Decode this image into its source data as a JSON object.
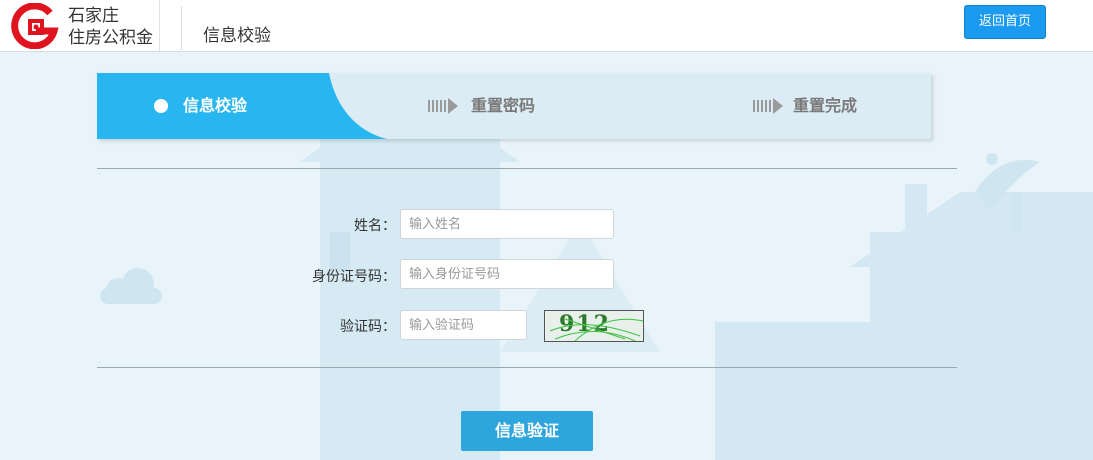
{
  "header": {
    "logo_line1": "石家庄",
    "logo_line2": "住房公积金",
    "title": "信息校验",
    "home_button": "返回首页"
  },
  "steps": [
    {
      "label": "信息校验",
      "active": true
    },
    {
      "label": "重置密码",
      "active": false
    },
    {
      "label": "重置完成",
      "active": false
    }
  ],
  "form": {
    "name_label": "姓名：",
    "name_placeholder": "输入姓名",
    "id_label": "身份证号码：",
    "id_placeholder": "输入身份证号码",
    "code_label": "验证码：",
    "code_placeholder": "输入验证码",
    "captcha_text": "912",
    "submit_label": "信息验证"
  },
  "colors": {
    "brand_red": "#e0141e",
    "accent_blue": "#1a9bf0",
    "step_active": "#28b6f0",
    "submit_blue": "#2ea5dc"
  },
  "icons": [
    "logo-icon",
    "step-dot-icon",
    "step-arrow-icon"
  ]
}
